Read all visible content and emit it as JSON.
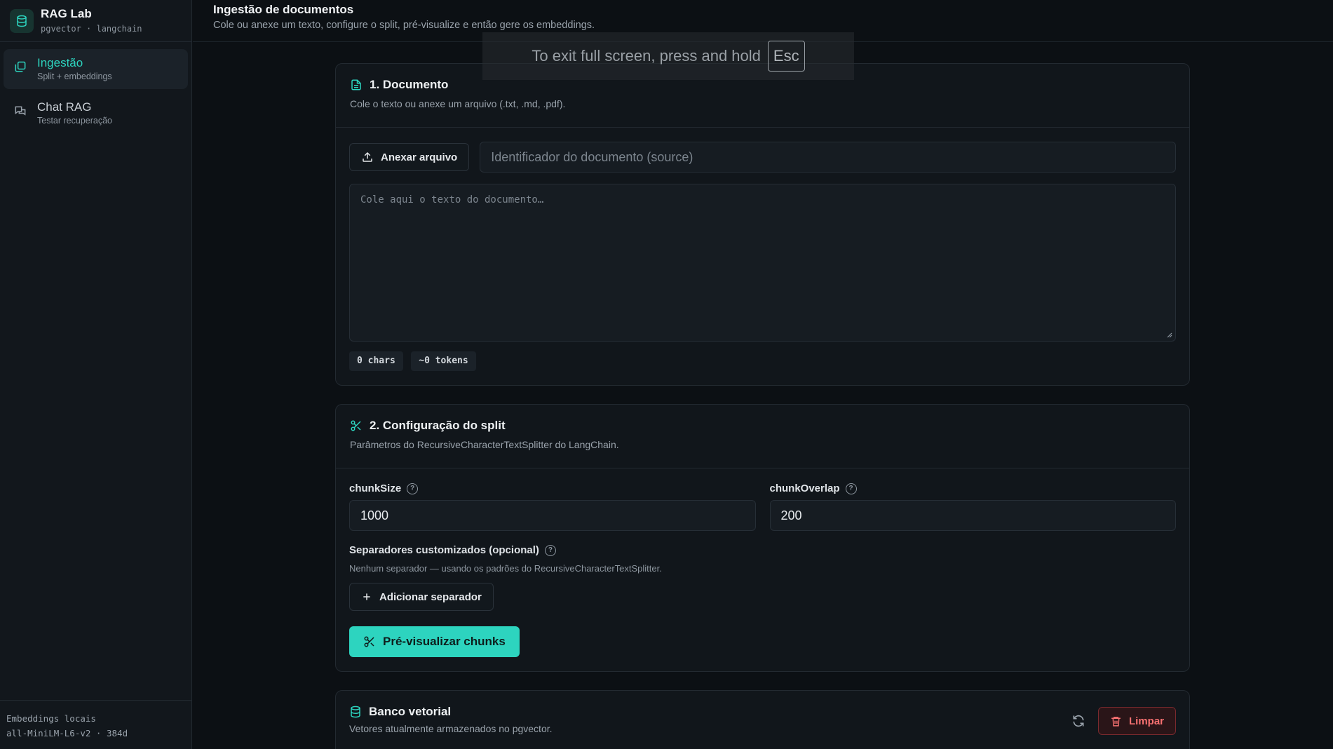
{
  "brand": {
    "title": "RAG Lab",
    "subtitle": "pgvector · langchain"
  },
  "nav": [
    {
      "label": "Ingestão",
      "sub": "Split + embeddings",
      "active": true
    },
    {
      "label": "Chat RAG",
      "sub": "Testar recuperação",
      "active": false
    }
  ],
  "sidebar_footer": {
    "line1": "Embeddings locais",
    "line2": "all-MiniLM-L6-v2 · 384d"
  },
  "header": {
    "title": "Ingestão de documentos",
    "subtitle": "Cole ou anexe um texto, configure o split, pré-visualize e então gere os embeddings."
  },
  "fullscreen_notice": {
    "text": "To exit full screen, press and hold",
    "key": "Esc"
  },
  "document": {
    "title": "1. Documento",
    "description": "Cole o texto ou anexe um arquivo (.txt, .md, .pdf).",
    "attach_label": "Anexar arquivo",
    "source_placeholder": "Identificador do documento (source)",
    "text_placeholder": "Cole aqui o texto do documento…",
    "chars": "0 chars",
    "tokens": "~0 tokens"
  },
  "split": {
    "title": "2. Configuração do split",
    "description": "Parâmetros do RecursiveCharacterTextSplitter do LangChain.",
    "chunk_size_label": "chunkSize",
    "chunk_size_value": "1000",
    "chunk_overlap_label": "chunkOverlap",
    "chunk_overlap_value": "200",
    "separators_label": "Separadores customizados (opcional)",
    "separators_hint": "Nenhum separador — usando os padrões do RecursiveCharacterTextSplitter.",
    "add_separator_label": "Adicionar separador",
    "preview_label": "Pré-visualizar chunks"
  },
  "vector_db": {
    "title": "Banco vetorial",
    "description": "Vetores atualmente armazenados no pgvector.",
    "clear_label": "Limpar"
  },
  "colors": {
    "accent": "#2dd4bf",
    "background": "#0c1014",
    "danger": "#f87171"
  }
}
